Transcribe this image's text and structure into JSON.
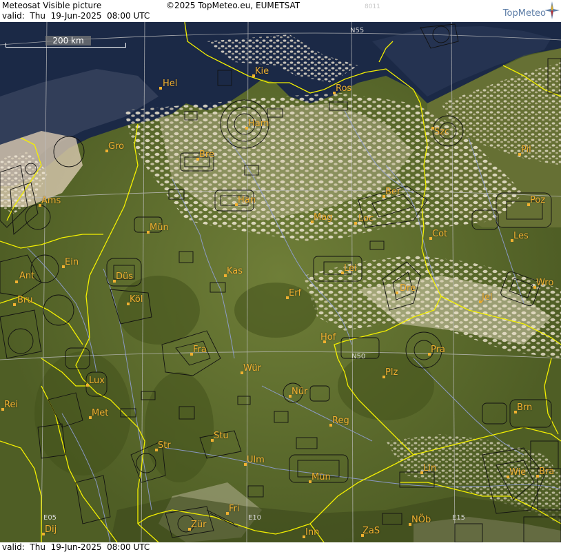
{
  "header": {
    "product": "Meteosat Visible picture",
    "copyright": "©2025 TopMeteo.eu, EUMETSAT",
    "code": "8011",
    "valid": "valid:  Thu  19-Jun-2025  08:00 UTC",
    "logo_text": "TopMeteo",
    "logo_icon": "compass-star-icon"
  },
  "footer": {
    "valid": "valid:  Thu  19-Jun-2025  08:00 UTC"
  },
  "scale": {
    "label": "200 km"
  },
  "grid_labels": {
    "n55": "N55",
    "n50": "N50",
    "e05": "E05",
    "e10": "E10",
    "e15": "E15"
  },
  "cities": [
    "Hel",
    "Kie",
    "Ros",
    "Ham",
    "Szc",
    "Gro",
    "Bre",
    "Pil",
    "Ams",
    "Han",
    "Ber",
    "Poz",
    "Mün",
    "Mag",
    "Loc",
    "Cot",
    "Les",
    "Ein",
    "Kas",
    "Lei",
    "Ant",
    "Düs",
    "Dre",
    "Wro",
    "Bru",
    "Köl",
    "Erf",
    "Jel",
    "Hof",
    "Fra",
    "Pra",
    "Würz",
    "Plz",
    "Lux",
    "Nür",
    "Rei",
    "Met",
    "Reg",
    "Brn",
    "Stu",
    "Str",
    "Ulm",
    "Lin",
    "Mün2",
    "Wie",
    "Bra",
    "Fri",
    "Dij",
    "Zür",
    "Inn",
    "Zas",
    "Nöb"
  ],
  "city_names": {
    "Hel": "Hel",
    "Kie": "Kie",
    "Ros": "Ros",
    "Ham": "Ham",
    "Szc": "Szc",
    "Gro": "Gro",
    "Bre": "Bre",
    "Pil": "Pil",
    "Ams": "Ams",
    "Han": "Han",
    "Ber": "Ber",
    "Poz": "Poz",
    "Mün": "Mün",
    "Mag": "Mag",
    "Loc": "Loc",
    "Cot": "Cot",
    "Les": "Les",
    "Ein": "Ein",
    "Kas": "Kas",
    "Lei": "Lei",
    "Ant": "Ant",
    "Düs": "Düs",
    "Dre": "Dre",
    "Wro": "Wro",
    "Bru": "Bru",
    "Köl": "Köl",
    "Erf": "Erf",
    "Jel": "Jel",
    "Hof": "Hof",
    "Fra": "Fra",
    "Pra": "Pra",
    "Würz": "Wür",
    "Plz": "Plz",
    "Lux": "Lux",
    "Nür": "Nür",
    "Rei": "Rei",
    "Met": "Met",
    "Reg": "Reg",
    "Brn": "Brn",
    "Stu": "Stu",
    "Str": "Str",
    "Ulm": "Ulm",
    "Lin": "Lin",
    "Mün2": "Mün",
    "Wie": "Wie",
    "Bra": "Bra",
    "Fri": "Fri",
    "Dij": "Dij",
    "Zür": "Zür",
    "Inn": "Inn",
    "Zas": "ZaS",
    "Nöb": "NÖb"
  },
  "colors": {
    "cities": "#f0b030",
    "borders": "#f4f000",
    "rivers": "#9aa8e8",
    "sea": "#1d2c48",
    "land": "#5e6e2e",
    "clouds": "#e8ddc8",
    "grid": "#bfbfbf",
    "airspace": "#000000"
  }
}
